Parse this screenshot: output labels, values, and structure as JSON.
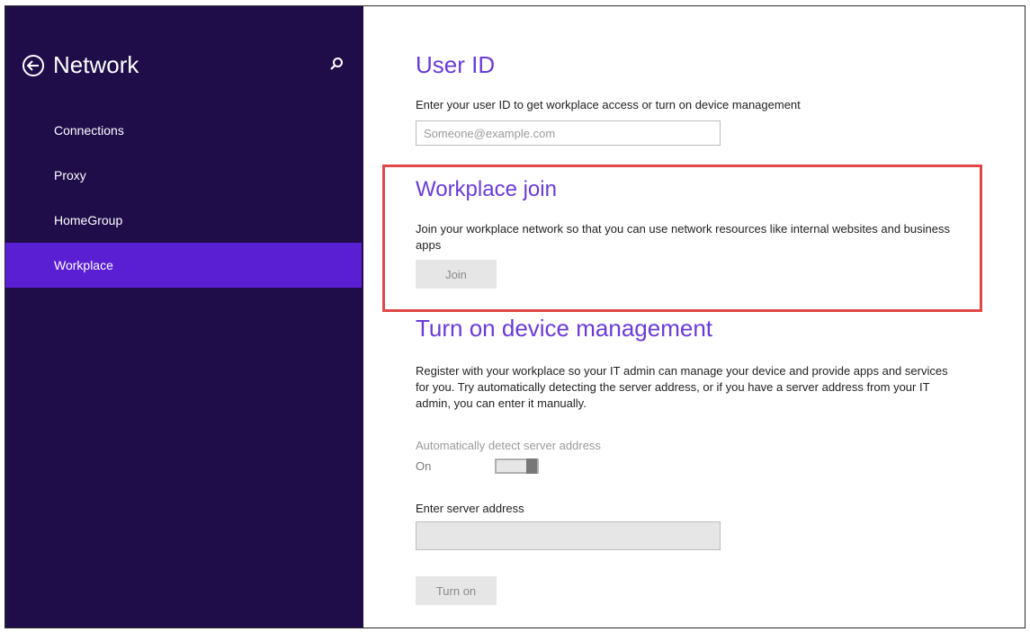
{
  "sidebar": {
    "title": "Network",
    "items": [
      {
        "label": "Connections"
      },
      {
        "label": "Proxy"
      },
      {
        "label": "HomeGroup"
      },
      {
        "label": "Workplace"
      }
    ]
  },
  "user_id": {
    "title": "User ID",
    "description": "Enter your user ID to get workplace access or turn on device management",
    "placeholder": "Someone@example.com"
  },
  "workplace_join": {
    "title": "Workplace join",
    "description": "Join your workplace network so that you can use network resources like internal websites and business apps",
    "button": "Join"
  },
  "device_management": {
    "title": "Turn on device management",
    "description": "Register with your workplace so your IT admin can manage your device and provide apps and services for you. Try automatically detecting the server address, or if you have a server address from your IT admin, you can enter it manually.",
    "auto_detect_label": "Automatically detect server address",
    "toggle_state": "On",
    "server_label": "Enter server address",
    "server_value": "",
    "button": "Turn on"
  },
  "colors": {
    "sidebar_bg": "#1f0d4a",
    "sidebar_active": "#5a1ed3",
    "accent": "#6a3bd8",
    "highlight_border": "#e04848"
  },
  "icons": [
    "back-arrow-icon",
    "search-icon"
  ]
}
